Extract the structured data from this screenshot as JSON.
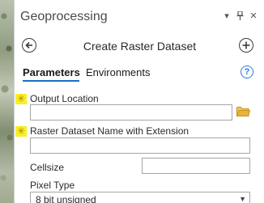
{
  "pane": {
    "title": "Geoprocessing",
    "menu_glyph": "▾",
    "pin_glyph": "ᵽ",
    "close_glyph": "✕"
  },
  "header": {
    "tool_title": "Create Raster Dataset",
    "back_icon": "back-arrow-icon",
    "add_icon": "add-icon"
  },
  "tabs": [
    {
      "label": "Parameters",
      "active": true
    },
    {
      "label": "Environments",
      "active": false
    }
  ],
  "help": {
    "glyph": "?"
  },
  "required_marker": "✳",
  "fields": {
    "output_location": {
      "label": "Output Location",
      "value": "",
      "required": true
    },
    "raster_name": {
      "label": "Raster Dataset Name with Extension",
      "value": "",
      "required": true
    },
    "cellsize": {
      "label": "Cellsize",
      "value": ""
    },
    "pixel_type": {
      "label": "Pixel Type",
      "value": "8 bit unsigned"
    }
  },
  "colors": {
    "accent": "#1b6ec2",
    "help": "#2a7de1",
    "required_highlight": "#f7ef2a",
    "folder": "#e8b33a"
  }
}
